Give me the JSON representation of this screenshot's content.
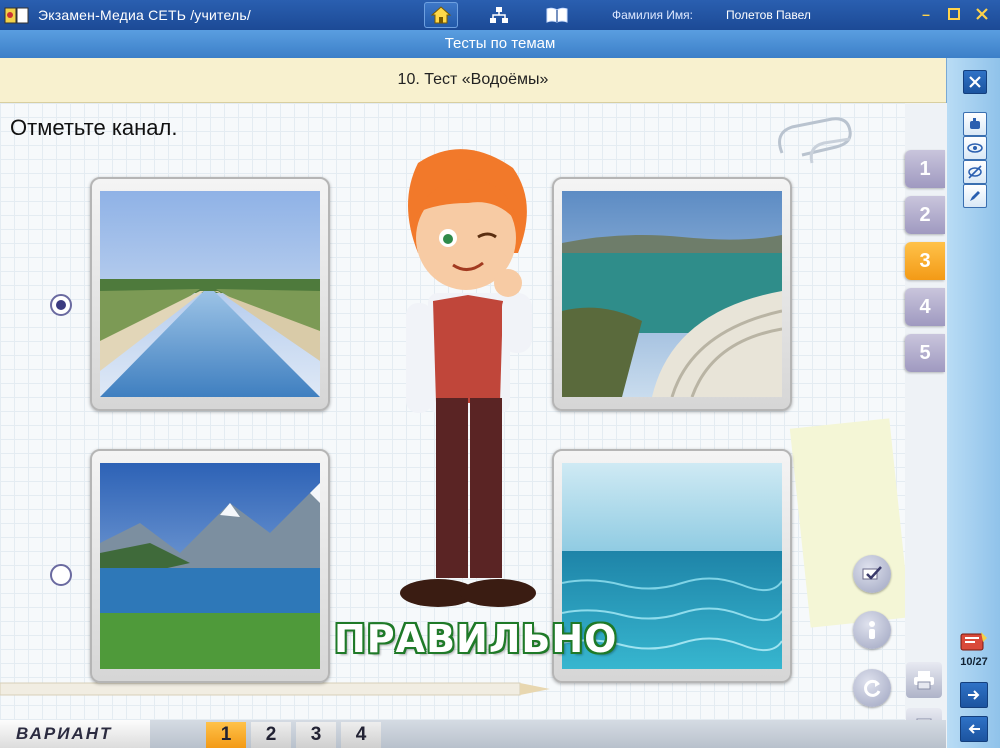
{
  "window": {
    "title": "Экзамен-Медиа СЕТЬ /учитель/",
    "user_label": "Фамилия Имя:",
    "user_name": "Полетов Павел"
  },
  "section_title": "Тесты по темам",
  "test_title": "10. Тест «Водоёмы»",
  "question": "Отметьте канал.",
  "answers": [
    {
      "id": 1,
      "image": "canal",
      "selected": true
    },
    {
      "id": 2,
      "image": "dam-reservoir",
      "selected": false
    },
    {
      "id": 3,
      "image": "mountain-lake",
      "selected": false
    },
    {
      "id": 4,
      "image": "sea",
      "selected": null
    }
  ],
  "feedback": "ПРАВИЛЬНО",
  "question_tabs": [
    {
      "label": "1",
      "active": false
    },
    {
      "label": "2",
      "active": false
    },
    {
      "label": "3",
      "active": true
    },
    {
      "label": "4",
      "active": false
    },
    {
      "label": "5",
      "active": false
    }
  ],
  "variant": {
    "label": "ВАРИАНТ",
    "tabs": [
      {
        "label": "1",
        "active": true
      },
      {
        "label": "2",
        "active": false
      },
      {
        "label": "3",
        "active": false
      },
      {
        "label": "4",
        "active": false
      }
    ]
  },
  "counter": "10/27",
  "colors": {
    "titlebar": "#1c4a96",
    "subheader": "#3c7fc8",
    "test_header_bg": "#f8f1cf",
    "active_tab": "#f39a16",
    "inactive_tab": "#9f99c0",
    "feedback_outline": "#1f7a28"
  }
}
